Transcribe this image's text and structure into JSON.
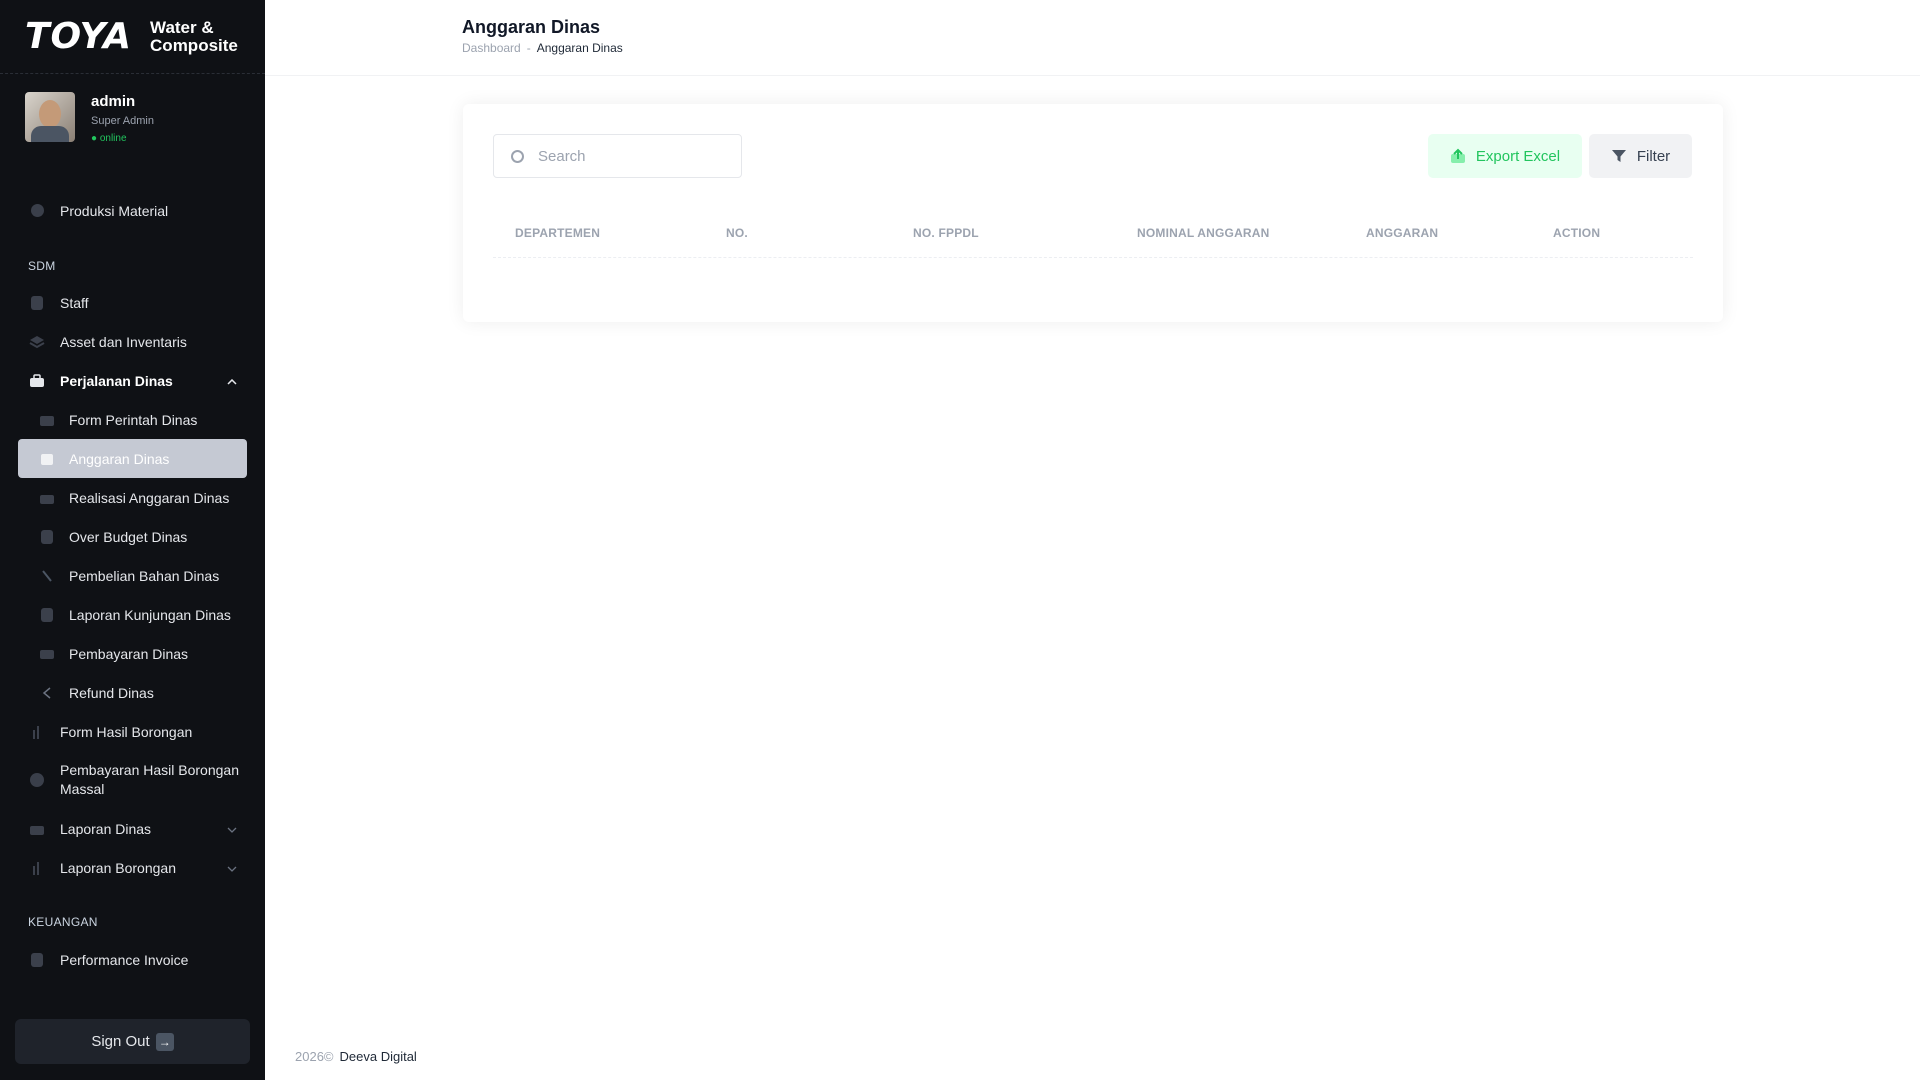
{
  "brand": {
    "logo": "TOYA",
    "subtitle_line1": "Water &",
    "subtitle_line2": "Composite"
  },
  "user": {
    "name": "admin",
    "role": "Super Admin",
    "status": "● online"
  },
  "sidebar": {
    "items_top": [
      {
        "label": "Produksi Material",
        "icon": "circle-icon"
      }
    ],
    "section_sdm": "SDM",
    "sdm_items": [
      {
        "label": "Staff",
        "icon": "staff-icon"
      },
      {
        "label": "Asset dan Inventaris",
        "icon": "layers-icon"
      },
      {
        "label": "Perjalanan Dinas",
        "icon": "briefcase-icon"
      }
    ],
    "dinas_sub": [
      {
        "label": "Form Perintah Dinas",
        "icon": "form-icon"
      },
      {
        "label": "Anggaran Dinas",
        "icon": "calendar-icon"
      },
      {
        "label": "Realisasi Anggaran Dinas",
        "icon": "briefcase-icon"
      },
      {
        "label": "Over Budget Dinas",
        "icon": "wallet-icon"
      },
      {
        "label": "Pembelian Bahan Dinas",
        "icon": "tools-icon"
      },
      {
        "label": "Laporan Kunjungan Dinas",
        "icon": "edit-icon"
      },
      {
        "label": "Pembayaran Dinas",
        "icon": "card-icon"
      },
      {
        "label": "Refund Dinas",
        "icon": "arrow-left-icon"
      }
    ],
    "sdm_more": [
      {
        "label": "Form Hasil Borongan",
        "icon": "chart-icon"
      },
      {
        "label": "Pembayaran Hasil Borongan",
        "label2": "Massal",
        "icon": "dollar-icon"
      },
      {
        "label": "Laporan Dinas",
        "icon": "briefcase-icon"
      },
      {
        "label": "Laporan Borongan",
        "icon": "chart-icon"
      }
    ],
    "section_keuangan": "KEUANGAN",
    "keuangan_items": [
      {
        "label": "Performance Invoice",
        "icon": "document-icon"
      }
    ],
    "sign_out": "Sign Out"
  },
  "header": {
    "title": "Anggaran Dinas",
    "breadcrumb": [
      "Dashboard",
      "Anggaran Dinas"
    ],
    "breadcrumb_sep": "-"
  },
  "toolbar": {
    "search_placeholder": "Search",
    "search_value": "",
    "export_label": "Export Excel",
    "filter_label": "Filter"
  },
  "table": {
    "columns": [
      "DEPARTEMEN",
      "NO.",
      "NO. FPPDL",
      "NOMINAL ANGGARAN",
      "ANGGARAN",
      "ACTION"
    ],
    "rows": []
  },
  "footer": {
    "year": "2026©",
    "company": "Deeva Digital"
  },
  "colors": {
    "sidebar_bg": "#0f1115",
    "active_bg": "#c5c9d3",
    "export_bg": "#e8fff1",
    "export_text": "#22c55e",
    "online": "#22c55e"
  }
}
